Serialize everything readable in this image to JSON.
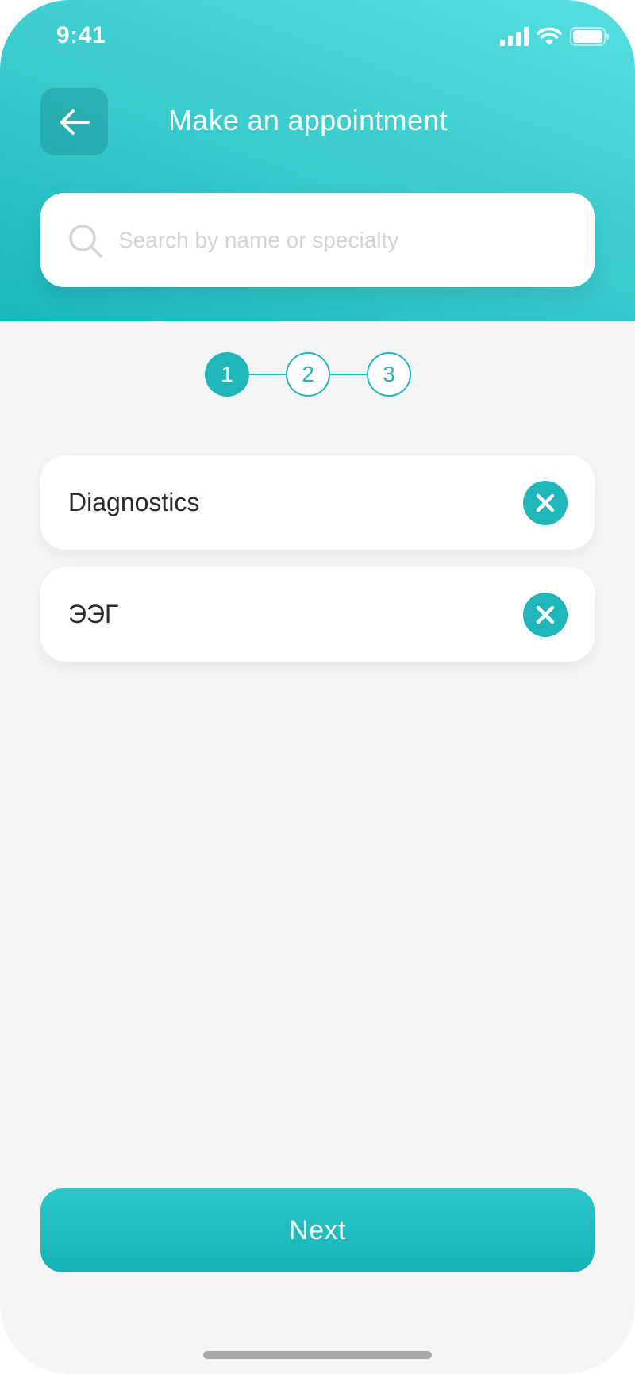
{
  "status_bar": {
    "time": "9:41",
    "icons": [
      "cellular-signal-icon",
      "wifi-icon",
      "battery-icon"
    ]
  },
  "header": {
    "back_icon": "arrow-left-icon",
    "title": "Make an appointment"
  },
  "search": {
    "icon": "search-icon",
    "value": "",
    "placeholder": "Search by name or specialty"
  },
  "stepper": {
    "current_step": 1,
    "steps": [
      {
        "label": "1",
        "state": "active"
      },
      {
        "label": "2",
        "state": "inactive"
      },
      {
        "label": "3",
        "state": "inactive"
      }
    ]
  },
  "selected_items": [
    {
      "label": "Diagnostics",
      "remove_icon": "close-icon"
    },
    {
      "label": "ЭЭГ",
      "remove_icon": "close-icon"
    }
  ],
  "footer": {
    "next_label": "Next"
  },
  "colors": {
    "accent": "#1fb7b9",
    "header_gradient_start": "#56dfe0",
    "header_gradient_end": "#19b6b8",
    "background": "#f5f5f6",
    "card": "#ffffff",
    "text_primary": "#2a2a2a",
    "placeholder": "#d2d4d6"
  }
}
